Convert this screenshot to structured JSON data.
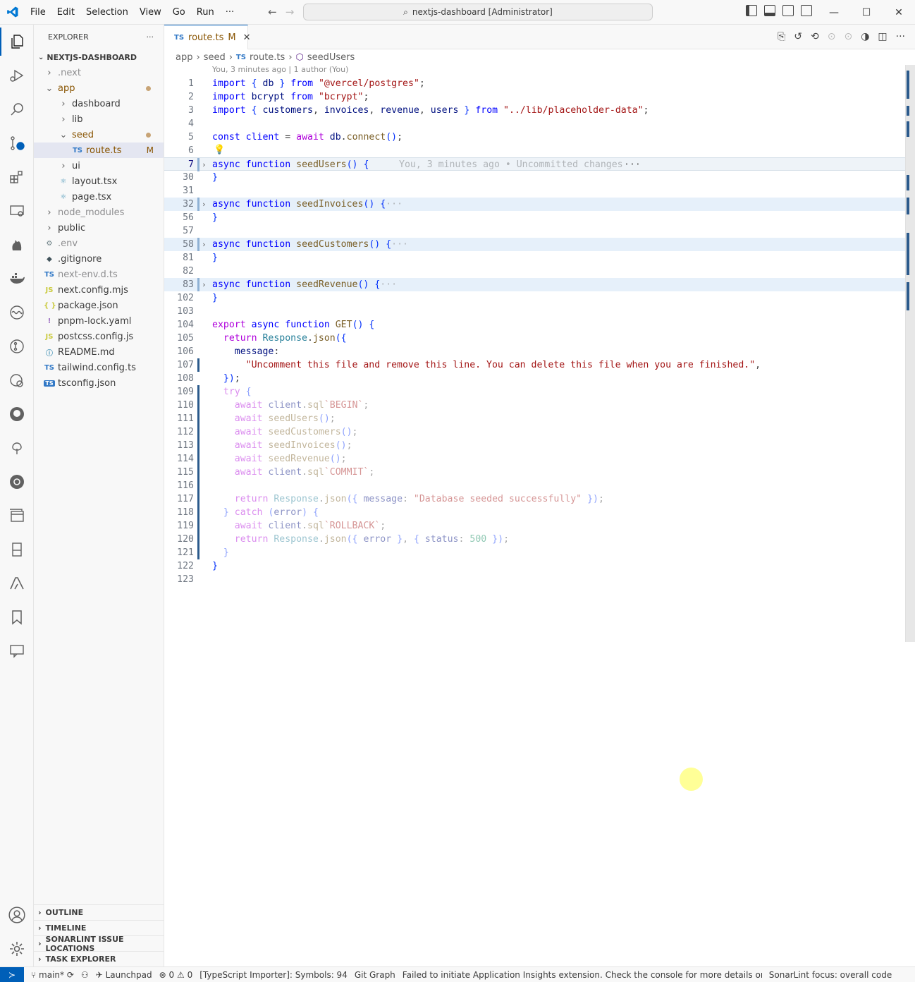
{
  "window": {
    "title": "nextjs-dashboard [Administrator]",
    "menu": [
      "File",
      "Edit",
      "Selection",
      "View",
      "Go",
      "Run",
      "···"
    ]
  },
  "sidebar": {
    "header": "EXPLORER",
    "root": "NEXTJS-DASHBOARD",
    "items": [
      {
        "label": ".next",
        "kind": "folder",
        "depth": 1,
        "open": false,
        "ignored": true
      },
      {
        "label": "app",
        "kind": "folder",
        "depth": 1,
        "open": true,
        "dot": true
      },
      {
        "label": "dashboard",
        "kind": "folder",
        "depth": 2,
        "open": false
      },
      {
        "label": "lib",
        "kind": "folder",
        "depth": 2,
        "open": false
      },
      {
        "label": "seed",
        "kind": "folder",
        "depth": 2,
        "open": true,
        "dot": true
      },
      {
        "label": "route.ts",
        "kind": "ts",
        "depth": 3,
        "badge": "M",
        "selected": true
      },
      {
        "label": "ui",
        "kind": "folder",
        "depth": 2,
        "open": false
      },
      {
        "label": "layout.tsx",
        "kind": "react",
        "depth": 2
      },
      {
        "label": "page.tsx",
        "kind": "react",
        "depth": 2
      },
      {
        "label": "node_modules",
        "kind": "folder",
        "depth": 1,
        "open": false,
        "ignored": true
      },
      {
        "label": "public",
        "kind": "folder",
        "depth": 1,
        "open": false
      },
      {
        "label": ".env",
        "kind": "gear",
        "depth": 1,
        "ignored": true
      },
      {
        "label": ".gitignore",
        "kind": "git",
        "depth": 1
      },
      {
        "label": "next-env.d.ts",
        "kind": "ts",
        "depth": 1,
        "ignored": true
      },
      {
        "label": "next.config.mjs",
        "kind": "js",
        "depth": 1
      },
      {
        "label": "package.json",
        "kind": "json",
        "depth": 1
      },
      {
        "label": "pnpm-lock.yaml",
        "kind": "yaml",
        "depth": 1
      },
      {
        "label": "postcss.config.js",
        "kind": "js",
        "depth": 1
      },
      {
        "label": "README.md",
        "kind": "info",
        "depth": 1
      },
      {
        "label": "tailwind.config.ts",
        "kind": "ts",
        "depth": 1
      },
      {
        "label": "tsconfig.json",
        "kind": "tsconfig",
        "depth": 1
      }
    ],
    "bottom_sections": [
      "OUTLINE",
      "TIMELINE",
      "SONARLINT ISSUE LOCATIONS",
      "TASK EXPLORER"
    ]
  },
  "editor": {
    "tab_label": "route.ts",
    "tab_lang": "TS",
    "tab_badge": "M",
    "breadcrumb": [
      "app",
      "seed",
      "route.ts",
      "seedUsers"
    ],
    "blame_header": "You, 3 minutes ago | 1 author (You)",
    "inline_blame": "You, 3 minutes ago • Uncommitted changes",
    "lines": [
      {
        "n": "1",
        "html": "<span class='k'>import</span> <span class='p'>{</span> <span class='v'>db</span> <span class='p'>}</span> <span class='k'>from</span> <span class='s'>\"@vercel/postgres\"</span>;"
      },
      {
        "n": "2",
        "html": "<span class='k'>import</span> <span class='v'>bcrypt</span> <span class='k'>from</span> <span class='s'>\"bcrypt\"</span>;"
      },
      {
        "n": "3",
        "html": "<span class='k'>import</span> <span class='p'>{</span> <span class='v'>customers</span>, <span class='v'>invoices</span>, <span class='v'>revenue</span>, <span class='v'>users</span> <span class='p'>}</span> <span class='k'>from</span> <span class='s'>\"../lib/placeholder-data\"</span>;"
      },
      {
        "n": "4",
        "html": ""
      },
      {
        "n": "5",
        "html": "<span class='k'>const</span> <span class='k'>client</span> = <span class='ctl'>await</span> <span class='v'>db</span>.<span class='f'>connect</span><span class='p'>()</span>;"
      },
      {
        "n": "6",
        "html": ""
      },
      {
        "n": "7",
        "html": "<span class='k'>async</span> <span class='k'>function</span> <span class='f'>seedUsers</span><span class='p'>()</span> <span class='p'>{</span>",
        "fold": true,
        "cursor": true
      },
      {
        "n": "30",
        "html": "<span class='p'>}</span>"
      },
      {
        "n": "31",
        "html": ""
      },
      {
        "n": "32",
        "html": "<span class='k'>async</span> <span class='k'>function</span> <span class='f'>seedInvoices</span><span class='p'>()</span> <span class='p'>{</span><span class='ghost'>···</span>",
        "fold": true,
        "hl": true
      },
      {
        "n": "56",
        "html": "<span class='p'>}</span>"
      },
      {
        "n": "57",
        "html": ""
      },
      {
        "n": "58",
        "html": "<span class='k'>async</span> <span class='k'>function</span> <span class='f'>seedCustomers</span><span class='p'>()</span> <span class='p'>{</span><span class='ghost'>···</span>",
        "fold": true,
        "hl": true
      },
      {
        "n": "81",
        "html": "<span class='p'>}</span>"
      },
      {
        "n": "82",
        "html": ""
      },
      {
        "n": "83",
        "html": "<span class='k'>async</span> <span class='k'>function</span> <span class='f'>seedRevenue</span><span class='p'>()</span> <span class='p'>{</span><span class='ghost'>···</span>",
        "fold": true,
        "hl": true
      },
      {
        "n": "102",
        "html": "<span class='p'>}</span>"
      },
      {
        "n": "103",
        "html": ""
      },
      {
        "n": "104",
        "html": "<span class='ctl'>export</span> <span class='k'>async</span> <span class='k'>function</span> <span class='f'>GET</span><span class='p'>()</span> <span class='p'>{</span>"
      },
      {
        "n": "105",
        "html": "  <span class='ctl'>return</span> <span class='t'>Response</span>.<span class='f'>json</span><span class='p'>({</span>"
      },
      {
        "n": "106",
        "html": "    <span class='v'>message</span>:"
      },
      {
        "n": "107",
        "html": "      <span class='s'>\"Uncomment this file and remove this line. You can delete this file when you are finished.\"</span>,"
      },
      {
        "n": "108",
        "html": "  <span class='p'>})</span>;"
      },
      {
        "n": "109",
        "html": "  <span class='ctl'>try</span> <span class='p'>{</span>",
        "faded": true
      },
      {
        "n": "110",
        "html": "    <span class='ctl'>await</span> <span class='v'>client</span>.<span class='f'>sql</span><span class='s'>`BEGIN`</span>;",
        "faded": true
      },
      {
        "n": "111",
        "html": "    <span class='ctl'>await</span> <span class='f'>seedUsers</span><span class='p'>()</span>;",
        "faded": true
      },
      {
        "n": "112",
        "html": "    <span class='ctl'>await</span> <span class='f'>seedCustomers</span><span class='p'>()</span>;",
        "faded": true
      },
      {
        "n": "113",
        "html": "    <span class='ctl'>await</span> <span class='f'>seedInvoices</span><span class='p'>()</span>;",
        "faded": true
      },
      {
        "n": "114",
        "html": "    <span class='ctl'>await</span> <span class='f'>seedRevenue</span><span class='p'>()</span>;",
        "faded": true
      },
      {
        "n": "115",
        "html": "    <span class='ctl'>await</span> <span class='v'>client</span>.<span class='f'>sql</span><span class='s'>`COMMIT`</span>;",
        "faded": true
      },
      {
        "n": "116",
        "html": ""
      },
      {
        "n": "117",
        "html": "    <span class='ctl'>return</span> <span class='t'>Response</span>.<span class='f'>json</span><span class='p'>({</span> <span class='v'>message</span>: <span class='s'>\"Database seeded successfully\"</span> <span class='p'>})</span>;",
        "faded": true
      },
      {
        "n": "118",
        "html": "  <span class='p'>}</span> <span class='ctl'>catch</span> <span class='p'>(</span><span class='v'>error</span><span class='p'>)</span> <span class='p'>{</span>",
        "faded": true
      },
      {
        "n": "119",
        "html": "    <span class='ctl'>await</span> <span class='v'>client</span>.<span class='f'>sql</span><span class='s'>`ROLLBACK`</span>;",
        "faded": true
      },
      {
        "n": "120",
        "html": "    <span class='ctl'>return</span> <span class='t'>Response</span>.<span class='f'>json</span><span class='p'>({</span> <span class='v'>error</span> <span class='p'>}</span>, <span class='p'>{</span> <span class='v'>status</span>: <span class='n'>500</span> <span class='p'>})</span>;",
        "faded": true
      },
      {
        "n": "121",
        "html": "  <span class='p'>}</span>",
        "faded": true
      },
      {
        "n": "122",
        "html": "<span class='p'>}</span>"
      },
      {
        "n": "123",
        "html": ""
      }
    ]
  },
  "statusbar": {
    "branch": "main*",
    "launchpad": "Launchpad",
    "errors": "0",
    "warnings": "0",
    "ts_importer": "[TypeScript Importer]: Symbols: 94",
    "git_graph": "Git Graph",
    "insights": "Failed to initiate Application Insights extension. Check the console for more details or reload the",
    "sonarlint": "SonarLint focus: overall code"
  },
  "colors": {
    "accent": "#005fb8",
    "modified": "#895503"
  }
}
